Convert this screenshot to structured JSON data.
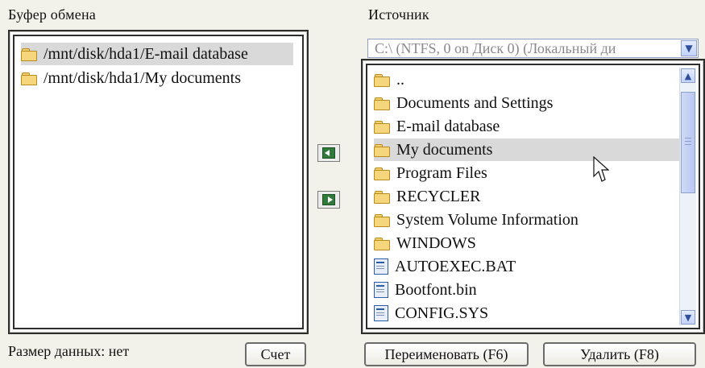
{
  "labels": {
    "clipboard": "Буфер обмена",
    "source": "Источник"
  },
  "clipboard_items": [
    {
      "path": "/mnt/disk/hda1/E-mail database",
      "selected": true
    },
    {
      "path": "/mnt/disk/hda1/My documents",
      "selected": false
    }
  ],
  "source_drive": "C:\\  (NTFS, 0 on Диск 0) (Локальный ди",
  "source_items": [
    {
      "name": "..",
      "type": "folder",
      "selected": false
    },
    {
      "name": "Documents and Settings",
      "type": "folder",
      "selected": false
    },
    {
      "name": "E-mail database",
      "type": "folder",
      "selected": false
    },
    {
      "name": "My documents",
      "type": "folder",
      "selected": true
    },
    {
      "name": "Program Files",
      "type": "folder",
      "selected": false
    },
    {
      "name": "RECYCLER",
      "type": "folder",
      "selected": false
    },
    {
      "name": "System Volume Information",
      "type": "folder",
      "selected": false
    },
    {
      "name": "WINDOWS",
      "type": "folder",
      "selected": false
    },
    {
      "name": "AUTOEXEC.BAT",
      "type": "file",
      "selected": false
    },
    {
      "name": "Bootfont.bin",
      "type": "file",
      "selected": false
    },
    {
      "name": "CONFIG.SYS",
      "type": "file",
      "selected": false
    }
  ],
  "footer": {
    "data_size_label": "Размер данных:",
    "data_size_value": "нет",
    "count_button": "Счет",
    "rename_button": "Переименовать (F6)",
    "delete_button": "Удалить (F8)"
  }
}
